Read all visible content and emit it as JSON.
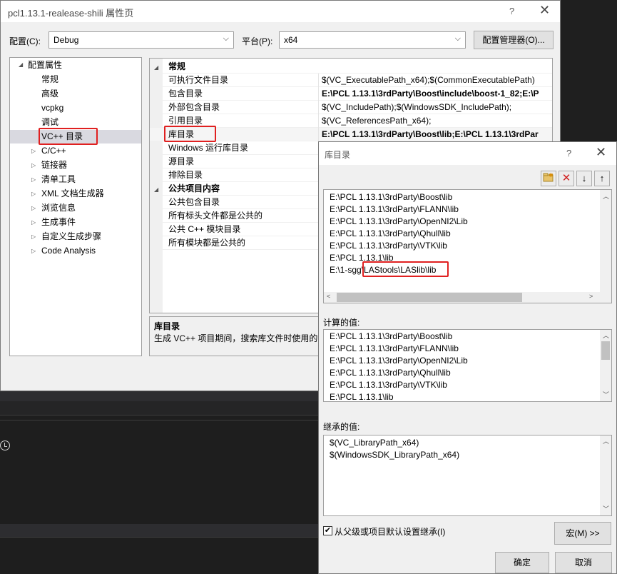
{
  "main_dialog": {
    "title": "pcl1.13.1-realease-shili 属性页",
    "help": "?",
    "close": "✕",
    "config_label": "配置(C):",
    "config_value": "Debug",
    "platform_label": "平台(P):",
    "platform_value": "x64",
    "config_manager_button": "配置管理器(O)...",
    "tree": {
      "root": "配置属性",
      "items": [
        "常规",
        "高级",
        "vcpkg",
        "调试",
        "VC++ 目录",
        "C/C++",
        "链接器",
        "清单工具",
        "XML 文档生成器",
        "浏览信息",
        "生成事件",
        "自定义生成步骤",
        "Code Analysis"
      ]
    },
    "grid": {
      "category_general": "常规",
      "rows": [
        {
          "name": "可执行文件目录",
          "value": "$(VC_ExecutablePath_x64);$(CommonExecutablePath)"
        },
        {
          "name": "包含目录",
          "value": "E:\\PCL 1.13.1\\3rdParty\\Boost\\include\\boost-1_82;E:\\P"
        },
        {
          "name": "外部包含目录",
          "value": "$(VC_IncludePath);$(WindowsSDK_IncludePath);"
        },
        {
          "name": "引用目录",
          "value": "$(VC_ReferencesPath_x64);"
        },
        {
          "name": "库目录",
          "value": "E:\\PCL 1.13.1\\3rdParty\\Boost\\lib;E:\\PCL 1.13.1\\3rdPar"
        },
        {
          "name": "Windows 运行库目录",
          "value": ""
        },
        {
          "name": "源目录",
          "value": ""
        },
        {
          "name": "排除目录",
          "value": ""
        }
      ],
      "category_public": "公共项目内容",
      "public_rows": [
        "公共包含目录",
        "所有标头文件都是公共的",
        "公共 C++ 模块目录",
        "所有模块都是公共的"
      ]
    },
    "description": {
      "title": "库目录",
      "text": "生成 VC++ 项目期间，搜索库文件时使用的"
    }
  },
  "lib_dialog": {
    "title": "库目录",
    "help": "?",
    "close": "✕",
    "toolbar_icons": [
      "new-line-icon",
      "delete-icon",
      "move-down-icon",
      "move-up-icon"
    ],
    "entries": [
      "E:\\PCL 1.13.1\\3rdParty\\Boost\\lib",
      "E:\\PCL 1.13.1\\3rdParty\\FLANN\\lib",
      "E:\\PCL 1.13.1\\3rdParty\\OpenNI2\\Lib",
      "E:\\PCL 1.13.1\\3rdParty\\Qhull\\lib",
      "E:\\PCL 1.13.1\\3rdParty\\VTK\\lib",
      "E:\\PCL 1.13.1\\lib",
      "E:\\1-sgg\\LAStools\\LASlib\\lib"
    ],
    "computed_label": "计算的值:",
    "computed_values": [
      "E:\\PCL 1.13.1\\3rdParty\\Boost\\lib",
      "E:\\PCL 1.13.1\\3rdParty\\FLANN\\lib",
      "E:\\PCL 1.13.1\\3rdParty\\OpenNI2\\Lib",
      "E:\\PCL 1.13.1\\3rdParty\\Qhull\\lib",
      "E:\\PCL 1.13.1\\3rdParty\\VTK\\lib",
      "E:\\PCL 1.13.1\\lib"
    ],
    "inherited_label": "继承的值:",
    "inherited_values": [
      "$(VC_LibraryPath_x64)",
      "$(WindowsSDK_LibraryPath_x64)"
    ],
    "inherit_checkbox": "从父级或项目默认设置继承(I)",
    "inherit_checked": true,
    "macro_button": "宏(M) >>",
    "ok_button": "确定",
    "cancel_button": "取消"
  },
  "colors": {
    "highlight": "#e02020",
    "selection": "#d9d9e0"
  }
}
